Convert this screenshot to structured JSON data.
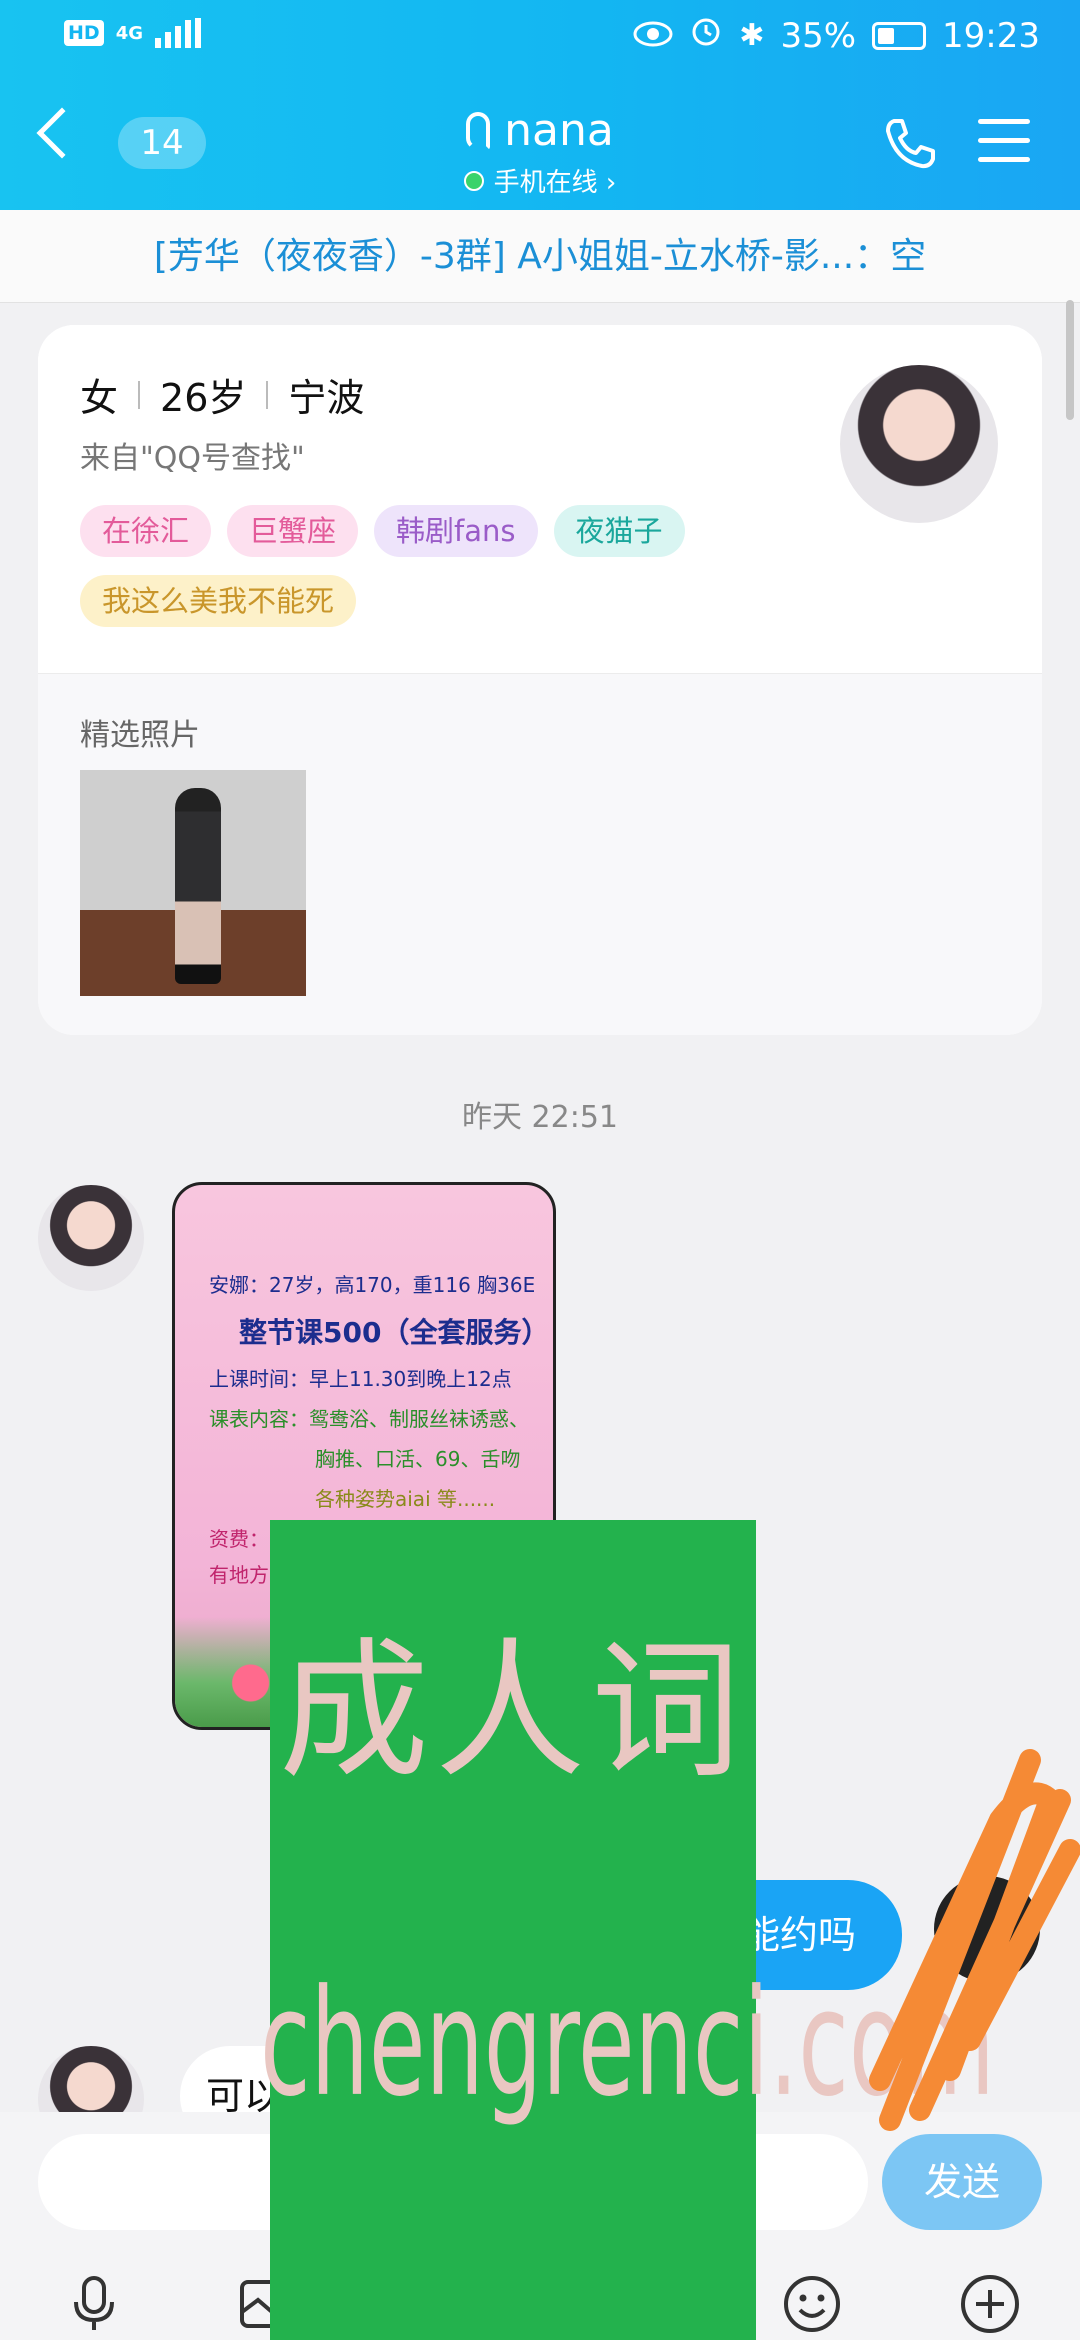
{
  "status_bar": {
    "network": "4G",
    "hd_label": "HD",
    "battery": "35%",
    "time": "19:23"
  },
  "header": {
    "unread_count": "14",
    "contact_name": "nana",
    "online_status": "手机在线 ›"
  },
  "group_banner": "[芳华（夜夜香）-3群] A小姐姐-立水桥-影...：空",
  "profile": {
    "gender": "女",
    "age": "26岁",
    "city": "宁波",
    "source": "来自\"QQ号查找\"",
    "tags": [
      "在徐汇",
      "巨蟹座",
      "韩剧fans",
      "夜猫子",
      "我这么美我不能死"
    ],
    "photos_label": "精选照片"
  },
  "chat": {
    "time_separator": "昨天 22:51",
    "poster": {
      "line1": "安娜：27岁，高170，重116 胸36E",
      "line2": "整节课500（全套服务）",
      "line3": "上课时间：早上11.30到晚上12点",
      "line4": "课表内容：鸳鸯浴、制服丝袜诱惑、",
      "line5": "胸推、口活、69、舌吻",
      "line6": "各种姿势aiai 等......",
      "line7": "资费：",
      "line8": "有地方"
    },
    "outgoing_text": "能约吗",
    "incoming_text": "可以"
  },
  "overlay": {
    "line1": "成人词",
    "line2": "chengrenci.com"
  },
  "input": {
    "send_label": "发送"
  },
  "colors": {
    "header_blue": "#13b6f2",
    "bubble_blue": "#1aa4f5",
    "overlay_green": "#23b24d",
    "scribble_orange": "#f58a35"
  }
}
